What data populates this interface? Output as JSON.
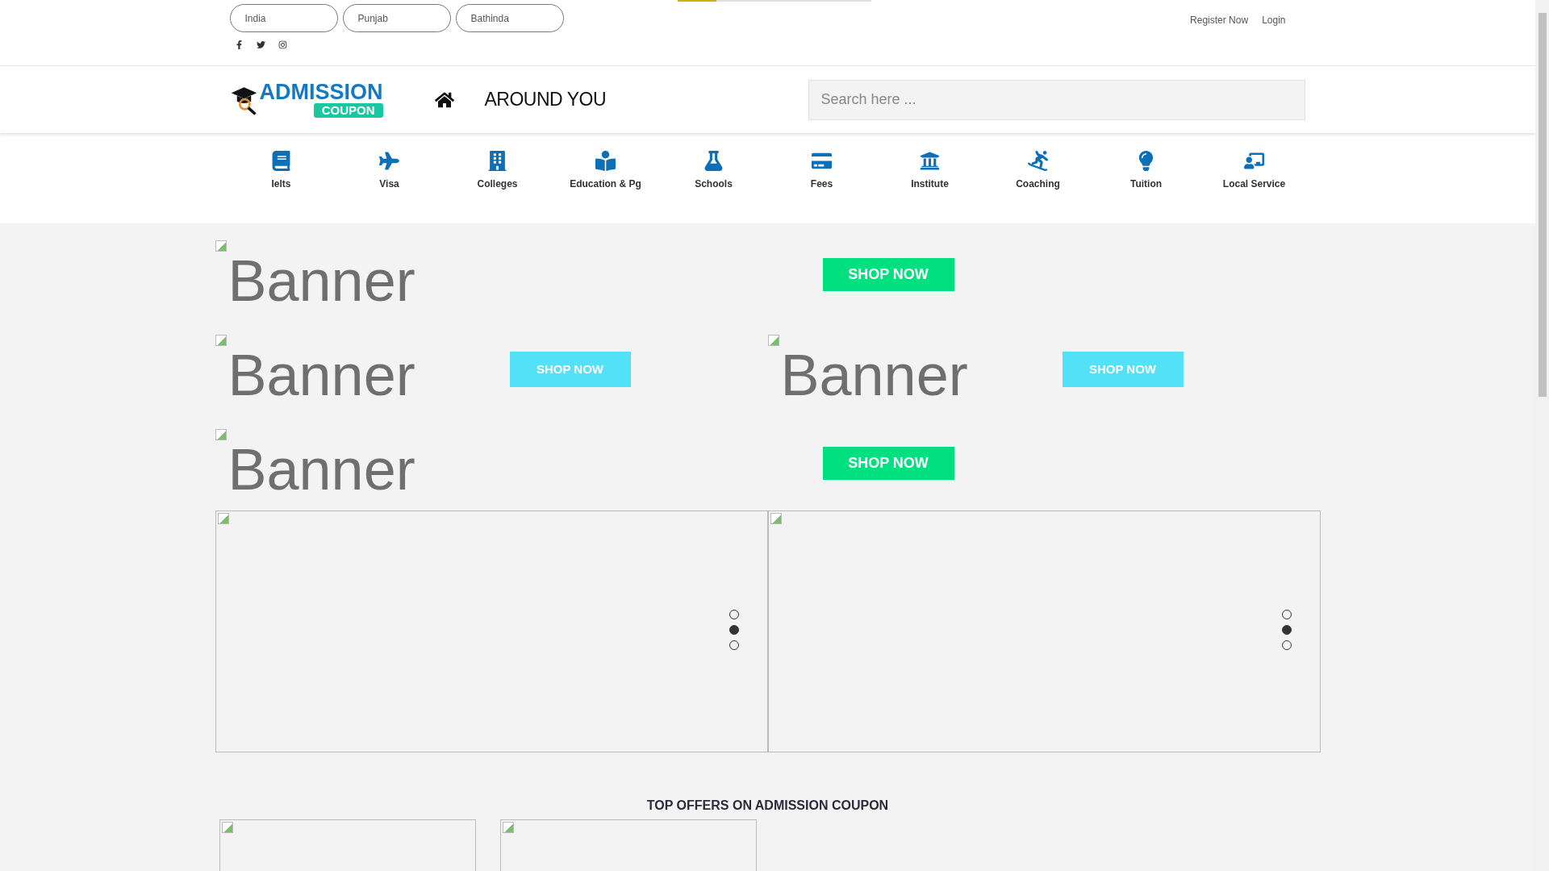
{
  "loading_bar": {
    "level": 0.2
  },
  "locations": [
    "India",
    "Punjab",
    "Bathinda"
  ],
  "account_links": [
    "Register Now",
    "Login"
  ],
  "logo": {
    "title": "ADMISSION",
    "tag": "COUPON"
  },
  "header_title": "AROUND YOU",
  "search": {
    "placeholder": "Search here ..."
  },
  "categories": [
    "Ielts",
    "Visa",
    "Colleges",
    "Education & Pg",
    "Schools",
    "Fees",
    "Institute",
    "Coaching",
    "Tuition",
    "Local Service"
  ],
  "banner_rows": [
    {
      "banners": [
        {
          "alt": "Banner",
          "button": "SHOP NOW",
          "kind": "wide"
        }
      ]
    },
    {
      "banners": [
        {
          "alt": "Banner",
          "button": "SHOP NOW",
          "kind": "half"
        },
        {
          "alt": "Banner",
          "button": "SHOP NOW",
          "kind": "half"
        }
      ]
    },
    {
      "banners": [
        {
          "alt": "Banner",
          "button": "SHOP NOW",
          "kind": "wide"
        }
      ]
    }
  ],
  "carousels": [
    {
      "dots": [
        {
          "selected": false
        },
        {
          "selected": true
        },
        {
          "selected": false
        }
      ]
    },
    {
      "dots": [
        {
          "selected": false
        },
        {
          "selected": true
        },
        {
          "selected": false
        }
      ]
    }
  ],
  "offers": {
    "title": "TOP OFFERS ON ADMISSION COUPON",
    "cards": [
      {
        "kind": "image"
      },
      {
        "kind": "image"
      }
    ]
  }
}
